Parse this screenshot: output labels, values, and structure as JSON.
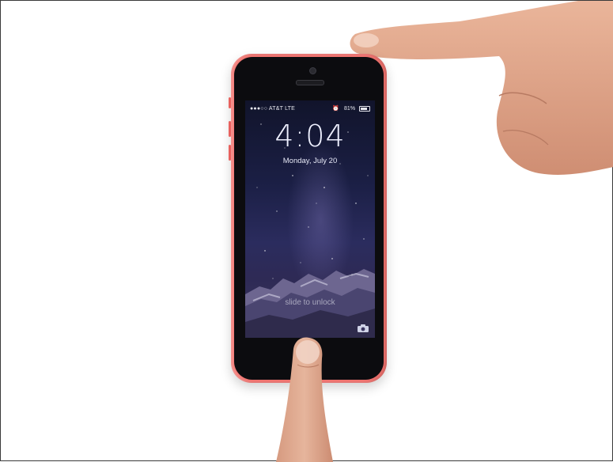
{
  "lock_screen": {
    "carrier": "●●●○○ AT&T  LTE",
    "alarm_icon": "alarm-icon",
    "battery": "81%",
    "battery_level": 0.81,
    "time": "4:04",
    "date": "Monday, July 20",
    "unlock_hint": "slide to unlock",
    "camera_icon": "camera-icon"
  },
  "colors": {
    "phone_body": "#f2736f",
    "phone_face": "#0c0c0f",
    "sky_top": "#11142b",
    "sky_bottom": "#3a3560",
    "skin": "#e3a98a"
  }
}
